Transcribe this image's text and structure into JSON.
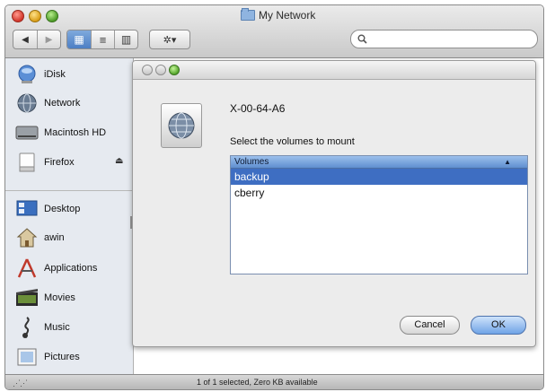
{
  "window": {
    "title": "My Network"
  },
  "toolbar": {
    "back_glyph": "◀",
    "forward_glyph": "▶",
    "view_icon_glyph": "▦",
    "view_list_glyph": "≡",
    "view_column_glyph": "▥",
    "action_glyph": "✲▾",
    "search_placeholder": ""
  },
  "sidebar": {
    "devices": [
      {
        "label": "iDisk",
        "icon": "idisk-icon"
      },
      {
        "label": "Network",
        "icon": "network-globe-icon"
      },
      {
        "label": "Macintosh HD",
        "icon": "hard-drive-icon"
      },
      {
        "label": "Firefox",
        "icon": "disk-image-icon",
        "eject": "⏏"
      }
    ],
    "places": [
      {
        "label": "Desktop",
        "icon": "desktop-icon"
      },
      {
        "label": "awin",
        "icon": "home-icon"
      },
      {
        "label": "Applications",
        "icon": "applications-icon"
      },
      {
        "label": "Movies",
        "icon": "movies-icon"
      },
      {
        "label": "Music",
        "icon": "music-icon"
      },
      {
        "label": "Pictures",
        "icon": "pictures-icon"
      }
    ]
  },
  "dialog": {
    "server_name": "X-00-64-A6",
    "prompt": "Select the volumes to mount",
    "list_header": "Volumes",
    "sort_glyph": "▲",
    "volumes": [
      "backup",
      "cberry"
    ],
    "selected_volume": "backup",
    "cancel_label": "Cancel",
    "ok_label": "OK"
  },
  "statusbar": {
    "text": "1 of 1 selected, Zero KB available",
    "grip_glyph": "⋰⋰"
  },
  "colors": {
    "selection": "#3e6ec2",
    "list_header": "#5f8fd0",
    "ok_button": "#6fa3e6"
  }
}
